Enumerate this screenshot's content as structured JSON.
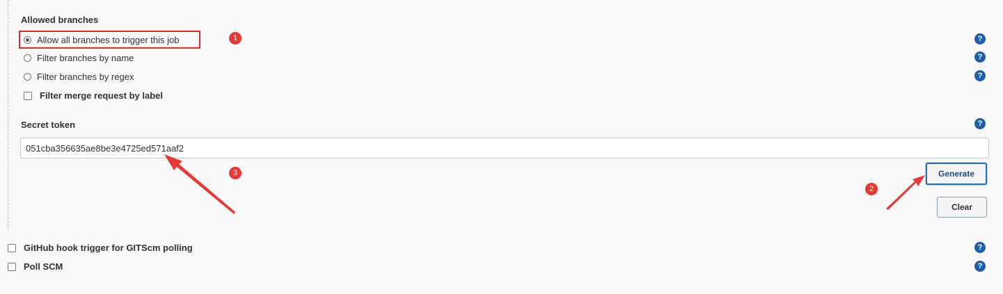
{
  "allowed_branches": {
    "label": "Allowed branches",
    "options": [
      {
        "label": "Allow all branches to trigger this job",
        "selected": true
      },
      {
        "label": "Filter branches by name",
        "selected": false
      },
      {
        "label": "Filter branches by regex",
        "selected": false
      }
    ],
    "merge_label_filter": {
      "label": "Filter merge request by label",
      "checked": false
    }
  },
  "secret_token": {
    "label": "Secret token",
    "value": "051cba356635ae8be3e4725ed571aaf2"
  },
  "buttons": {
    "generate": "Generate",
    "clear": "Clear"
  },
  "triggers": [
    {
      "label": "GitHub hook trigger for GITScm polling",
      "checked": false
    },
    {
      "label": "Poll SCM",
      "checked": false
    }
  ],
  "annotations": {
    "marker_1": "1",
    "marker_2": "2",
    "marker_3": "3"
  },
  "help_icon_glyph": "?",
  "colors": {
    "annotation_red": "#e53935",
    "help_blue": "#1f5fa8"
  }
}
